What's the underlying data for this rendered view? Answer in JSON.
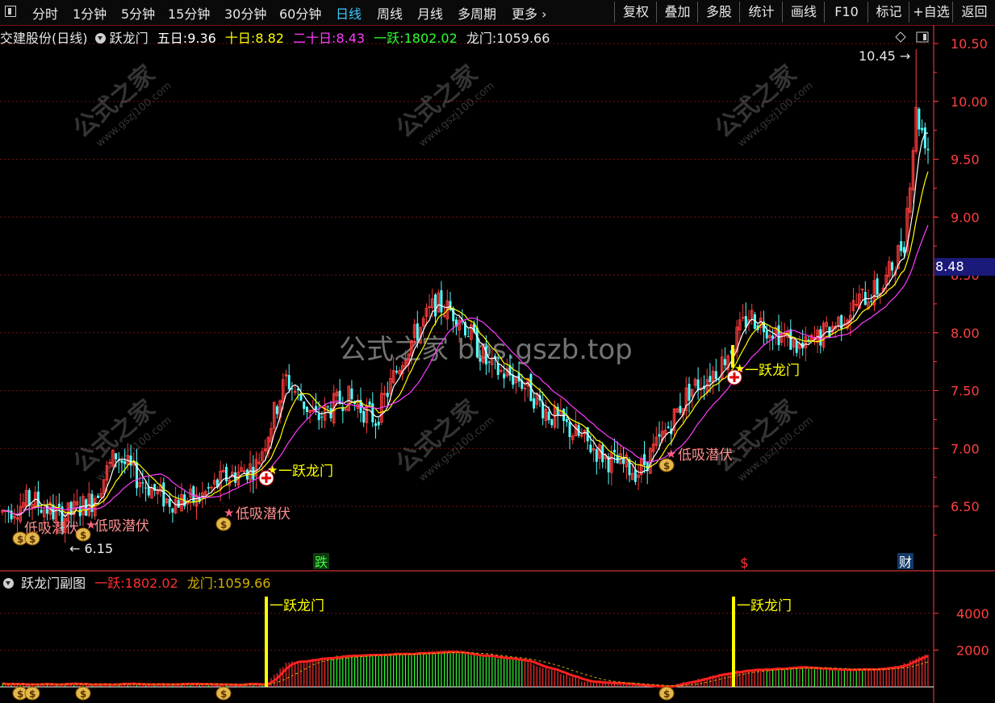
{
  "toolbar": {
    "left_tabs": [
      {
        "label": "分时",
        "active": false
      },
      {
        "label": "1分钟",
        "active": false
      },
      {
        "label": "5分钟",
        "active": false
      },
      {
        "label": "15分钟",
        "active": false
      },
      {
        "label": "30分钟",
        "active": false
      },
      {
        "label": "60分钟",
        "active": false
      },
      {
        "label": "日线",
        "active": true
      },
      {
        "label": "周线",
        "active": false
      },
      {
        "label": "月线",
        "active": false
      },
      {
        "label": "多周期",
        "active": false
      },
      {
        "label": "更多",
        "active": false
      }
    ],
    "right_tabs": [
      "复权",
      "叠加",
      "多股",
      "统计",
      "画线",
      "F10",
      "标记",
      "+自选",
      "返回"
    ]
  },
  "main": {
    "title": "交建股份(日线)",
    "indicator_name": "跃龙门",
    "ma5_label": "五日:",
    "ma5_value": "9.36",
    "ma10_label": "十日:",
    "ma10_value": "8.82",
    "ma20_label": "二十日:",
    "ma20_value": "8.43",
    "yiyue_label": "一跃:",
    "yiyue_value": "1802.02",
    "longmen_label": "龙门:",
    "longmen_value": "1059.66",
    "current_price": "8.48",
    "high_label": "10.45",
    "low_label": "6.15",
    "watermark_center": "公式之家 bbs.gszb.top",
    "watermark_tile_cn": "公式之家",
    "watermark_tile_en": "www.gszj100.com",
    "annotations": {
      "yiyue_longmen": "一跃龙门",
      "dixi_qianfu": "低吸潜伏"
    },
    "bottom_markers": {
      "die": "跌",
      "cai": "财",
      "dollar": "$"
    },
    "colors": {
      "up": "#ff3c3c",
      "down": "#54ffff",
      "ma5": "#ffffff",
      "ma10": "#ffff00",
      "ma20": "#ff3cff",
      "grid": "#7a1010",
      "axis": "#ff4040"
    }
  },
  "sub": {
    "title": "跃龙门副图",
    "yiyue_label": "一跃:",
    "yiyue_value": "1802.02",
    "longmen_label": "龙门:",
    "longmen_value": "1059.66",
    "annotation": "一跃龙门"
  },
  "chart_data": {
    "type": "candlestick",
    "y_axis_ticks": [
      "10.50",
      "10.00",
      "9.50",
      "9.00",
      "8.50",
      "8.00",
      "7.50",
      "7.00",
      "6.50"
    ],
    "ylim": [
      6.15,
      10.6
    ],
    "sub_y_axis_ticks": [
      "4000",
      "2000"
    ],
    "sub_ylim": [
      0,
      5000
    ],
    "ma_lines": [
      {
        "name": "五日",
        "value": 9.36
      },
      {
        "name": "十日",
        "value": 8.82
      },
      {
        "name": "二十日",
        "value": 8.43
      }
    ]
  }
}
